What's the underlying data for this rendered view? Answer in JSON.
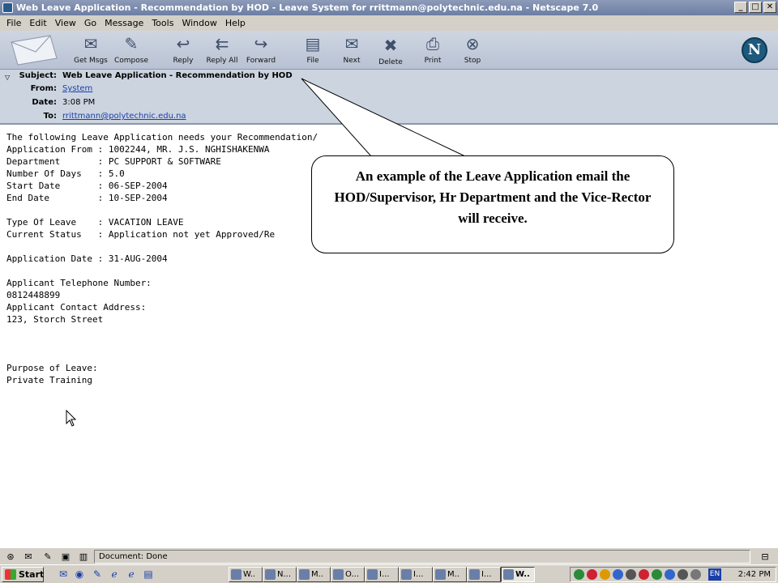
{
  "window": {
    "title": "Web Leave Application - Recommendation by HOD - Leave System for rrittmann@polytechnic.edu.na - Netscape 7.0",
    "controls": [
      "_",
      "□",
      "✕"
    ]
  },
  "menu": [
    "File",
    "Edit",
    "View",
    "Go",
    "Message",
    "Tools",
    "Window",
    "Help"
  ],
  "toolbar": {
    "buttons": [
      {
        "label": "Get Msgs",
        "icon": "get-msgs-icon"
      },
      {
        "label": "Compose",
        "icon": "compose-icon"
      },
      {
        "label": "Reply",
        "icon": "reply-icon"
      },
      {
        "label": "Reply All",
        "icon": "reply-all-icon"
      },
      {
        "label": "Forward",
        "icon": "forward-icon"
      },
      {
        "label": "File",
        "icon": "file-icon"
      },
      {
        "label": "Next",
        "icon": "next-icon"
      },
      {
        "label": "Delete",
        "icon": "delete-icon"
      },
      {
        "label": "Print",
        "icon": "print-icon"
      },
      {
        "label": "Stop",
        "icon": "stop-icon"
      }
    ],
    "logo": "N"
  },
  "header": {
    "subject_label": "Subject:",
    "subject": "Web Leave Application - Recommendation by HOD",
    "from_label": "From:",
    "from": "System",
    "date_label": "Date:",
    "date": "3:08 PM",
    "to_label": "To:",
    "to": "rrittmann@polytechnic.edu.na"
  },
  "body_lines": [
    "The following Leave Application needs your Recommendation/",
    "Application From : 1002244, MR. J.S. NGHISHAKENWA",
    "Department       : PC SUPPORT & SOFTWARE",
    "Number Of Days   : 5.0",
    "Start Date       : 06-SEP-2004",
    "End Date         : 10-SEP-2004",
    "",
    "Type Of Leave    : VACATION LEAVE",
    "Current Status   : Application not yet Approved/Re",
    "",
    "Application Date : 31-AUG-2004",
    "",
    "Applicant Telephone Number:",
    "0812448899",
    "Applicant Contact Address:",
    "123, Storch Street",
    "",
    "",
    "",
    "Purpose of Leave:",
    "Private Training"
  ],
  "callout": {
    "text": "An example of the Leave Application email the HOD/Supervisor, Hr Department and the Vice-Rector will receive."
  },
  "statusbar": {
    "text": "Document: Done"
  },
  "taskbar": {
    "start": "Start",
    "tasks": [
      "W..",
      "N...",
      "M..",
      "O...",
      "I...",
      "I...",
      "M..",
      "I...",
      "W.."
    ],
    "lang": "EN",
    "clock": "2:42 PM"
  }
}
